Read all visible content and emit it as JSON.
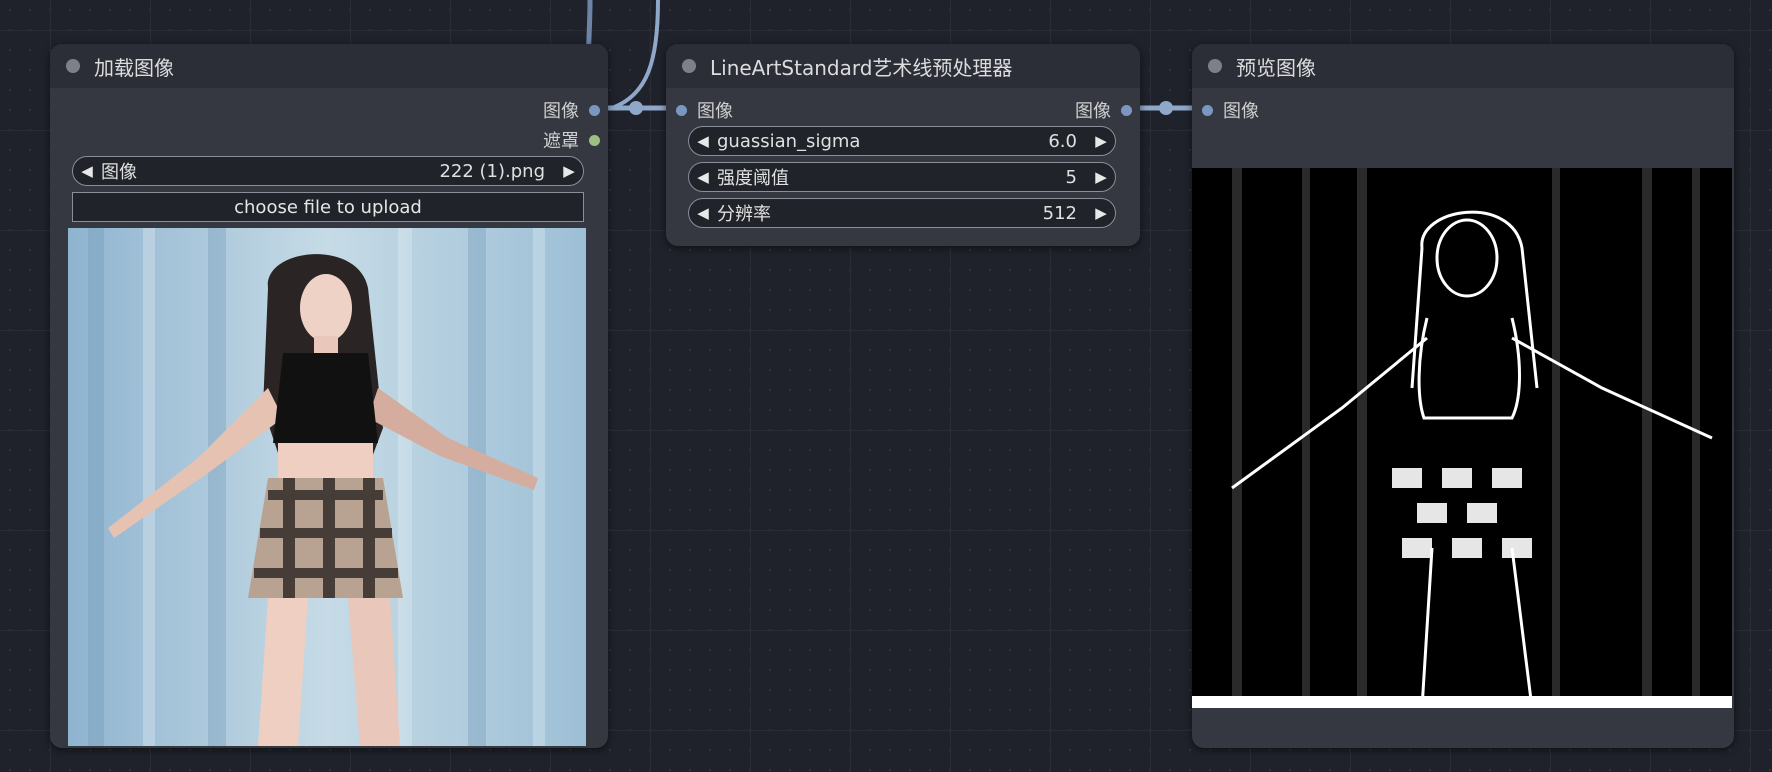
{
  "nodes": {
    "load_image": {
      "title": "加载图像",
      "outputs": [
        "图像",
        "遮罩"
      ],
      "widget": {
        "label": "图像",
        "value": "222 (1).png"
      },
      "upload_label": "choose file to upload"
    },
    "lineart": {
      "title": "LineArtStandard艺术线预处理器",
      "input": "图像",
      "output": "图像",
      "widgets": [
        {
          "label": "guassian_sigma",
          "value": "6.0"
        },
        {
          "label": "强度阈值",
          "value": "5"
        },
        {
          "label": "分辨率",
          "value": "512"
        }
      ]
    },
    "preview": {
      "title": "预览图像",
      "input": "图像"
    }
  },
  "colors": {
    "canvas": "#1f222a",
    "node_body": "#353841",
    "node_header": "#2b2e37",
    "image_port": "#7a97c2",
    "mask_port": "#9dbf86",
    "wire": "#8fa7c8"
  },
  "icons": {
    "decrement": "left-triangle",
    "increment": "right-triangle"
  }
}
